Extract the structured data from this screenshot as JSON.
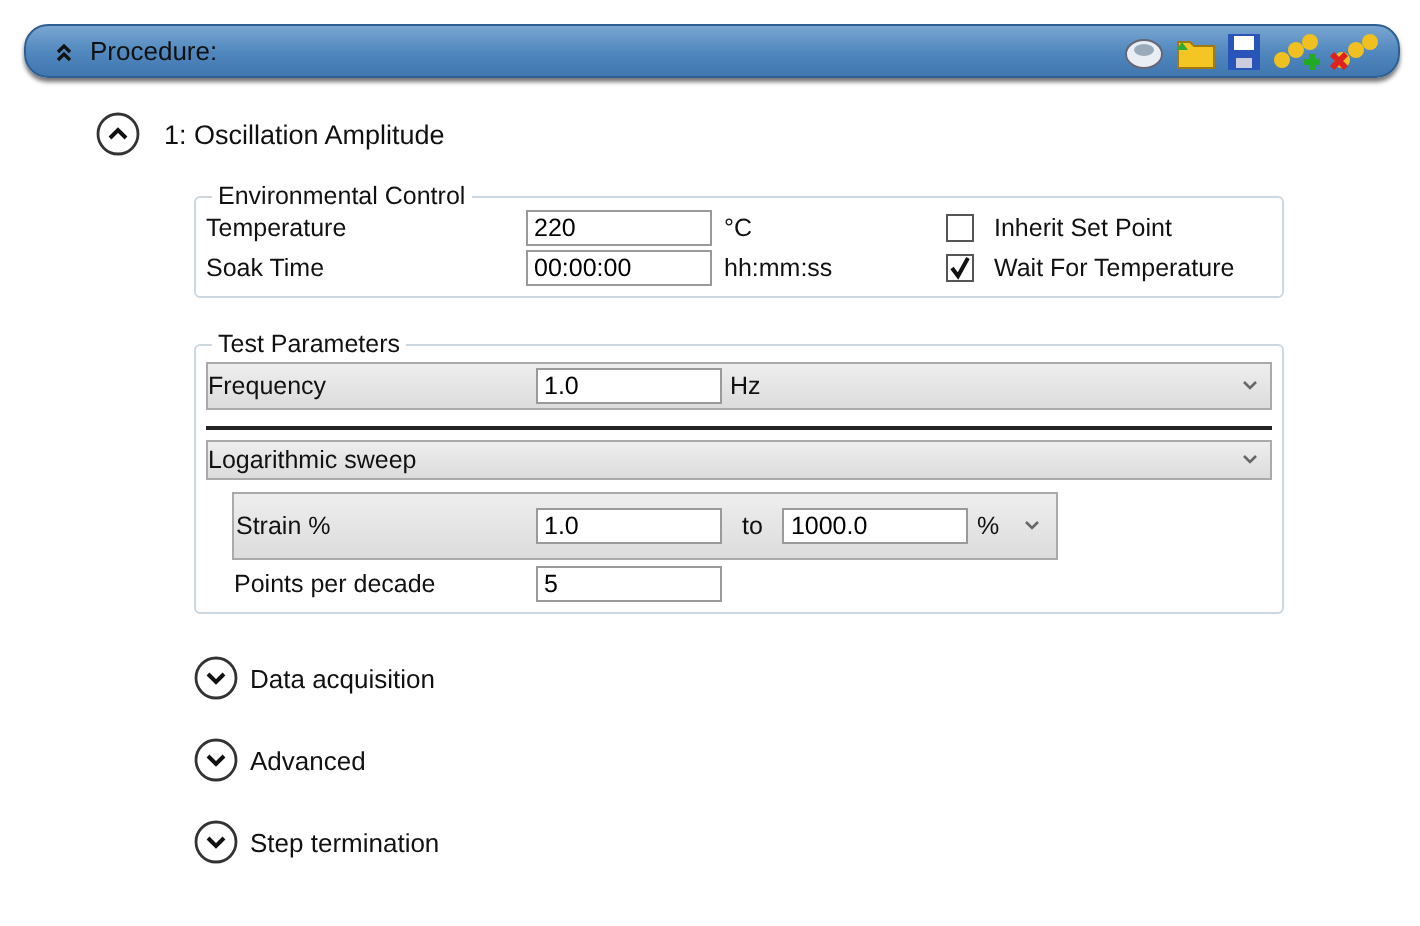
{
  "header": {
    "title": "Procedure:",
    "expanded": true
  },
  "step": {
    "title": "1: Oscillation Amplitude",
    "expanded": true
  },
  "environmental_control": {
    "legend": "Environmental Control",
    "fields": [
      {
        "label": "Temperature",
        "value": "220",
        "unit": "°C",
        "option": {
          "label": "Inherit Set Point",
          "checked": false
        }
      },
      {
        "label": "Soak Time",
        "value": "00:00:00",
        "unit": "hh:mm:ss",
        "option": {
          "label": "Wait For Temperature",
          "checked": true
        }
      }
    ]
  },
  "test_parameters": {
    "legend": "Test Parameters",
    "frequency": {
      "label": "Frequency",
      "value": "1.0",
      "unit": "Hz"
    },
    "sweep": {
      "mode": "Logarithmic sweep",
      "strain": {
        "label": "Strain %",
        "from": "1.0",
        "to_label": "to",
        "to": "1000.0",
        "unit": "%"
      },
      "points": {
        "label": "Points per decade",
        "value": "5"
      }
    }
  },
  "sections": [
    {
      "title": "Data acquisition",
      "expanded": false
    },
    {
      "title": "Advanced",
      "expanded": false
    },
    {
      "title": "Step termination",
      "expanded": false
    }
  ]
}
